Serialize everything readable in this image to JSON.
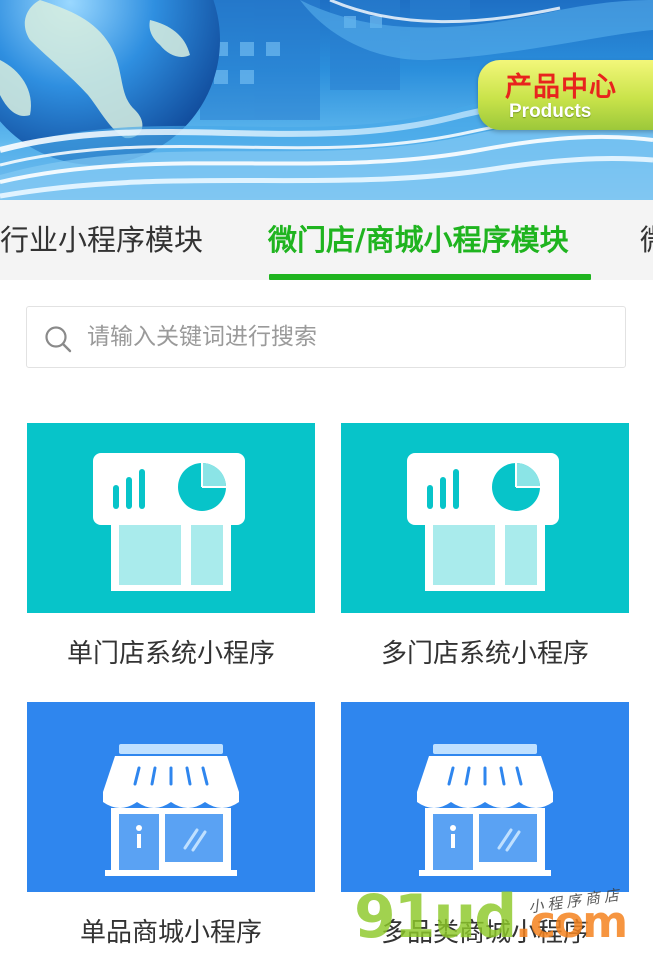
{
  "banner": {
    "badge_title": "产品中心",
    "badge_subtitle": "Products"
  },
  "tabs": [
    {
      "label": "行业小程序模块",
      "active": false
    },
    {
      "label": "微门店/商城小程序模块",
      "active": true
    },
    {
      "label": "微",
      "active": false
    }
  ],
  "search": {
    "placeholder": "请输入关键词进行搜索",
    "value": ""
  },
  "products": [
    {
      "label": "单门店系统小程序",
      "icon": "dashboard-store-icon",
      "bg_color": "#07c4c9"
    },
    {
      "label": "多门店系统小程序",
      "icon": "dashboard-store-icon",
      "bg_color": "#07c4c9"
    },
    {
      "label": "单品商城小程序",
      "icon": "shop-awning-icon",
      "bg_color": "#2f86ee"
    },
    {
      "label": "多品类商城小程序",
      "icon": "shop-awning-icon",
      "bg_color": "#2f86ee"
    }
  ],
  "watermark": {
    "logo_text": "91ud",
    "logo_suffix": ".com",
    "caption": "小程序商店"
  },
  "colors": {
    "accent": "#1fb41f",
    "teal": "#07c4c9",
    "blue": "#2f86ee",
    "badge_red": "#e8231d"
  }
}
